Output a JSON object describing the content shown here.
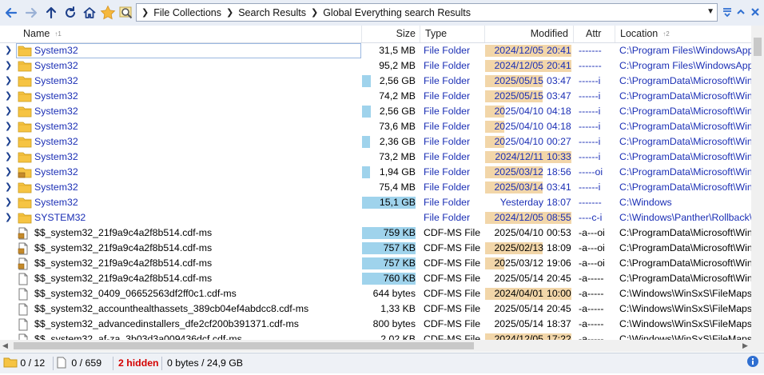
{
  "toolbar": {
    "icons": [
      "arrow-left-icon",
      "arrow-right-icon",
      "arrow-up-icon",
      "refresh-icon",
      "home-icon",
      "star-icon",
      "search-icon"
    ],
    "breadcrumb": [
      "File Collections",
      "Search Results",
      "Global Everything search Results"
    ]
  },
  "columns": {
    "name": "Name",
    "name_sort": "↑1",
    "size": "Size",
    "type": "Type",
    "modified": "Modified",
    "attr": "Attr",
    "location": "Location",
    "location_sort": "↑2"
  },
  "rows": [
    {
      "kind": "folder",
      "name": "System32",
      "size": "31,5 MB",
      "size_fill": 0,
      "type": "File Folder",
      "date": "2024/12/05",
      "time": "20:41",
      "mod_fill": "full",
      "attr": "-------",
      "loc": "C:\\Program Files\\WindowsApps\\"
    },
    {
      "kind": "folder",
      "name": "System32",
      "size": "95,2 MB",
      "size_fill": 0,
      "type": "File Folder",
      "date": "2024/12/05",
      "time": "20:41",
      "mod_fill": "full",
      "attr": "-------",
      "loc": "C:\\Program Files\\WindowsApps\\"
    },
    {
      "kind": "folder",
      "name": "System32",
      "size": "2,56 GB",
      "size_fill": 0.16,
      "type": "File Folder",
      "date": "2025/05/15",
      "time": "03:47",
      "mod_fill": "date",
      "attr": "------i",
      "loc": "C:\\ProgramData\\Microsoft\\Windows"
    },
    {
      "kind": "folder",
      "name": "System32",
      "size": "74,2 MB",
      "size_fill": 0,
      "type": "File Folder",
      "date": "2025/05/15",
      "time": "03:47",
      "mod_fill": "date",
      "attr": "------i",
      "loc": "C:\\ProgramData\\Microsoft\\Windows"
    },
    {
      "kind": "folder",
      "name": "System32",
      "size": "2,56 GB",
      "size_fill": 0.16,
      "type": "File Folder",
      "date": "2025/04/10",
      "time": "04:18",
      "mod_fill": "year",
      "attr": "------i",
      "loc": "C:\\ProgramData\\Microsoft\\Windows"
    },
    {
      "kind": "folder",
      "name": "System32",
      "size": "73,6 MB",
      "size_fill": 0,
      "type": "File Folder",
      "date": "2025/04/10",
      "time": "04:18",
      "mod_fill": "year",
      "attr": "------i",
      "loc": "C:\\ProgramData\\Microsoft\\Windows"
    },
    {
      "kind": "folder",
      "name": "System32",
      "size": "2,36 GB",
      "size_fill": 0.15,
      "type": "File Folder",
      "date": "2025/04/10",
      "time": "00:27",
      "mod_fill": "year",
      "attr": "------i",
      "loc": "C:\\ProgramData\\Microsoft\\Windows"
    },
    {
      "kind": "folder",
      "name": "System32",
      "size": "73,2 MB",
      "size_fill": 0,
      "type": "File Folder",
      "date": "2024/12/11",
      "time": "10:33",
      "mod_fill": "full",
      "attr": "------i",
      "loc": "C:\\ProgramData\\Microsoft\\Windows"
    },
    {
      "kind": "lockfolder",
      "name": "System32",
      "size": "1,94 GB",
      "size_fill": 0.12,
      "type": "File Folder",
      "date": "2025/03/12",
      "time": "18:56",
      "mod_fill": "date",
      "attr": "-----oi",
      "loc": "C:\\ProgramData\\Microsoft\\Windows"
    },
    {
      "kind": "folder",
      "name": "System32",
      "size": "75,4 MB",
      "size_fill": 0,
      "type": "File Folder",
      "date": "2025/03/14",
      "time": "03:41",
      "mod_fill": "date",
      "attr": "------i",
      "loc": "C:\\ProgramData\\Microsoft\\Windows"
    },
    {
      "kind": "folder",
      "name": "System32",
      "size": "15,1 GB",
      "size_fill": 1,
      "type": "File Folder",
      "date": "Yesterday",
      "time": "18:07",
      "mod_fill": "none",
      "attr": "-------",
      "loc": "C:\\Windows"
    },
    {
      "kind": "folder",
      "name": "SYSTEM32",
      "size": "",
      "size_fill": 0,
      "type": "File Folder",
      "date": "2024/12/05",
      "time": "08:55",
      "mod_fill": "full",
      "attr": "----c-i",
      "loc": "C:\\Windows\\Panther\\Rollback\\"
    },
    {
      "kind": "lockfile",
      "name": "$$_system32_21f9a9c4a2f8b514.cdf-ms",
      "size": "759 KB",
      "size_fill": 1,
      "type": "CDF-MS File",
      "date": "2025/04/10",
      "time": "00:53",
      "mod_fill": "none",
      "attr": "-a---oi",
      "loc": "C:\\ProgramData\\Microsoft\\Windows"
    },
    {
      "kind": "lockfile",
      "name": "$$_system32_21f9a9c4a2f8b514.cdf-ms",
      "size": "757 KB",
      "size_fill": 1,
      "type": "CDF-MS File",
      "date": "2025/02/13",
      "time": "18:09",
      "mod_fill": "date",
      "attr": "-a---oi",
      "loc": "C:\\ProgramData\\Microsoft\\Windows"
    },
    {
      "kind": "lockfile",
      "name": "$$_system32_21f9a9c4a2f8b514.cdf-ms",
      "size": "757 KB",
      "size_fill": 1,
      "type": "CDF-MS File",
      "date": "2025/03/12",
      "time": "19:06",
      "mod_fill": "year",
      "attr": "-a---oi",
      "loc": "C:\\ProgramData\\Microsoft\\Windows"
    },
    {
      "kind": "file",
      "name": "$$_system32_21f9a9c4a2f8b514.cdf-ms",
      "size": "760 KB",
      "size_fill": 1,
      "type": "CDF-MS File",
      "date": "2025/05/14",
      "time": "20:45",
      "mod_fill": "none",
      "attr": "-a-----",
      "loc": "C:\\ProgramData\\Microsoft\\Windows"
    },
    {
      "kind": "file",
      "name": "$$_system32_0409_06652563df2ff0c1.cdf-ms",
      "size": "644 bytes",
      "size_fill": 0,
      "type": "CDF-MS File",
      "date": "2024/04/01",
      "time": "10:00",
      "mod_fill": "full",
      "attr": "-a-----",
      "loc": "C:\\Windows\\WinSxS\\FileMaps"
    },
    {
      "kind": "file",
      "name": "$$_system32_accounthealthassets_389cb04ef4abdcc8.cdf-ms",
      "size": "1,33 KB",
      "size_fill": 0,
      "type": "CDF-MS File",
      "date": "2025/05/14",
      "time": "20:45",
      "mod_fill": "none",
      "attr": "-a-----",
      "loc": "C:\\Windows\\WinSxS\\FileMaps"
    },
    {
      "kind": "file",
      "name": "$$_system32_advancedinstallers_dfe2cf200b391371.cdf-ms",
      "size": "800 bytes",
      "size_fill": 0,
      "type": "CDF-MS File",
      "date": "2025/05/14",
      "time": "18:37",
      "mod_fill": "none",
      "attr": "-a-----",
      "loc": "C:\\Windows\\WinSxS\\FileMaps"
    },
    {
      "kind": "file",
      "name": "$$_system32_af-za_3b03d3a009436dcf.cdf-ms",
      "size": "2,02 KB",
      "size_fill": 0,
      "type": "CDF-MS File",
      "date": "2024/12/05",
      "time": "17:22",
      "mod_fill": "full",
      "attr": "-a-----",
      "loc": "C:\\Windows\\WinSxS\\FileMaps"
    }
  ],
  "status": {
    "folders": "0 / 12",
    "files": "0 / 659",
    "hidden": "2 hidden",
    "bytes": "0 bytes / 24,9 GB"
  },
  "colors": {
    "size_bar": "#9fd3ec",
    "modified_bar": "#f2d6a9",
    "link_blue": "#1b2fb5",
    "hidden_red": "#d40000"
  }
}
